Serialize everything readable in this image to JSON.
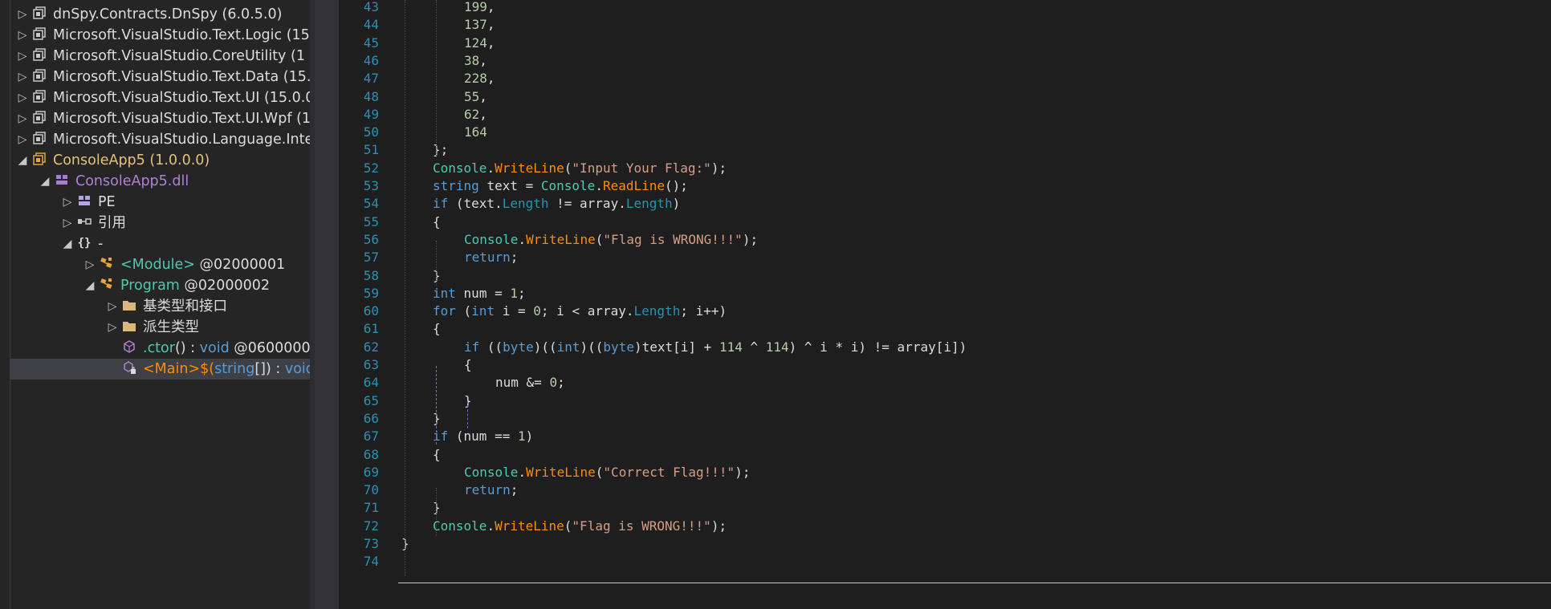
{
  "tree": {
    "nodes": [
      {
        "text": "dnSpy.Contracts.DnSpy",
        "version": "(6.0.5.0)",
        "style": "white",
        "arrow": "▷",
        "indent": 0,
        "icon": "assembly-icon"
      },
      {
        "text": "Microsoft.VisualStudio.Text.Logic",
        "version": "(15",
        "style": "white",
        "arrow": "▷",
        "indent": 0,
        "icon": "assembly-icon"
      },
      {
        "text": "Microsoft.VisualStudio.CoreUtility",
        "version": "(1",
        "style": "white",
        "arrow": "▷",
        "indent": 0,
        "icon": "assembly-icon"
      },
      {
        "text": "Microsoft.VisualStudio.Text.Data",
        "version": "(15.",
        "style": "white",
        "arrow": "▷",
        "indent": 0,
        "icon": "assembly-icon"
      },
      {
        "text": "Microsoft.VisualStudio.Text.UI",
        "version": "(15.0.0",
        "style": "white",
        "arrow": "▷",
        "indent": 0,
        "icon": "assembly-icon"
      },
      {
        "text": "Microsoft.VisualStudio.Text.UI.Wpf",
        "version": "(1",
        "style": "white",
        "arrow": "▷",
        "indent": 0,
        "icon": "assembly-icon"
      },
      {
        "text": "Microsoft.VisualStudio.Language.Inte",
        "version": "",
        "style": "white",
        "arrow": "▷",
        "indent": 0,
        "icon": "assembly-icon"
      },
      {
        "text": "ConsoleApp5",
        "version": "(1.0.0.0)",
        "style": "yellow",
        "arrow": "◢",
        "indent": 0,
        "icon": "assembly-open-icon"
      },
      {
        "text": "ConsoleApp5.dll",
        "version": "",
        "style": "purple",
        "arrow": "◢",
        "indent": 1,
        "icon": "module-icon"
      },
      {
        "text": "PE",
        "version": "",
        "style": "white",
        "arrow": "▷",
        "indent": 2,
        "icon": "pe-icon"
      },
      {
        "text": "引用",
        "version": "",
        "style": "white",
        "arrow": "▷",
        "indent": 2,
        "icon": "references-icon"
      },
      {
        "text": "-",
        "version": "",
        "style": "white",
        "arrow": "◢",
        "indent": 2,
        "icon": "namespace-icon"
      },
      {
        "text": "<Module>",
        "version": "@02000001",
        "style": "teal",
        "arrow": "▷",
        "indent": 3,
        "icon": "class-icon"
      },
      {
        "text": "Program",
        "version": "@02000002",
        "style": "teal",
        "arrow": "◢",
        "indent": 3,
        "icon": "class-icon"
      },
      {
        "text": "基类型和接口",
        "version": "",
        "style": "white",
        "arrow": "▷",
        "indent": 4,
        "icon": "folder-icon"
      },
      {
        "text": "派生类型",
        "version": "",
        "style": "white",
        "arrow": "▷",
        "indent": 4,
        "icon": "folder-icon"
      },
      {
        "text": ".ctor",
        "version": "",
        "style": "ctor",
        "arrow": "",
        "indent": 4,
        "icon": "method-icon",
        "sig": "() : ",
        "ret": "void",
        "tail": " @0600000"
      },
      {
        "text": "<Main>$",
        "version": "",
        "style": "main",
        "arrow": "",
        "indent": 4,
        "icon": "method-private-icon",
        "sig": "(",
        "argtype": "string",
        "sig2": "[]) : ",
        "ret": "void",
        "selected": true
      }
    ]
  },
  "editor": {
    "lines": [
      {
        "n": "43",
        "c": "199,"
      },
      {
        "n": "44",
        "c": "137,"
      },
      {
        "n": "45",
        "c": "124,"
      },
      {
        "n": "46",
        "c": "38,"
      },
      {
        "n": "47",
        "c": "228,"
      },
      {
        "n": "48",
        "c": "55,"
      },
      {
        "n": "49",
        "c": "62,"
      },
      {
        "n": "50",
        "c": "164"
      },
      {
        "n": "51",
        "c": "};"
      },
      {
        "n": "52",
        "c": "Console.WriteLine(\"Input Your Flag:\");"
      },
      {
        "n": "53",
        "c": "string text = Console.ReadLine();"
      },
      {
        "n": "54",
        "c": "if (text.Length != array.Length)"
      },
      {
        "n": "55",
        "c": "{"
      },
      {
        "n": "56",
        "c": "Console.WriteLine(\"Flag is WRONG!!!\");"
      },
      {
        "n": "57",
        "c": "return;"
      },
      {
        "n": "58",
        "c": "}"
      },
      {
        "n": "59",
        "c": "int num = 1;"
      },
      {
        "n": "60",
        "c": "for (int i = 0; i < array.Length; i++)"
      },
      {
        "n": "61",
        "c": "{"
      },
      {
        "n": "62",
        "c": "if ((byte)((int)((byte)text[i] + 114 ^ 114) ^ i * i) != array[i])"
      },
      {
        "n": "63",
        "c": "{"
      },
      {
        "n": "64",
        "c": "num &= 0;"
      },
      {
        "n": "65",
        "c": "}"
      },
      {
        "n": "66",
        "c": "}"
      },
      {
        "n": "67",
        "c": "if (num == 1)"
      },
      {
        "n": "68",
        "c": "{"
      },
      {
        "n": "69",
        "c": "Console.WriteLine(\"Correct Flag!!!\");"
      },
      {
        "n": "70",
        "c": "return;"
      },
      {
        "n": "71",
        "c": "}"
      },
      {
        "n": "72",
        "c": "Console.WriteLine(\"Flag is WRONG!!!\");"
      },
      {
        "n": "73",
        "c": "}"
      },
      {
        "n": "74",
        "c": ""
      }
    ]
  },
  "colors": {
    "keyword": "#569cd6",
    "type": "#4ec9b0",
    "method": "#ff8c00",
    "property": "#2b91af",
    "string": "#d69d85",
    "number": "#b5cea8",
    "line_number": "#2b91af",
    "assembly_name": "#e6c07b",
    "module_name": "#b180d7"
  }
}
